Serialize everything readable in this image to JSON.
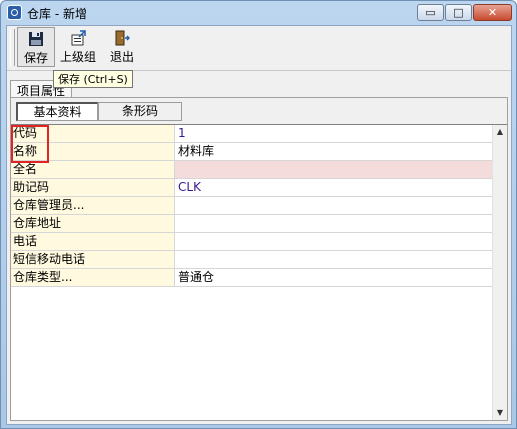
{
  "window": {
    "title": "仓库 - 新增",
    "controls": {
      "minimize": "▭",
      "maximize": "□",
      "close": "✕"
    }
  },
  "toolbar": {
    "save_label": "保存",
    "parent_label": "上级组",
    "exit_label": "退出",
    "tooltip": "保存 (Ctrl+S)"
  },
  "tabs": {
    "outer_label": "项目属性",
    "basic_label": "基本资料",
    "barcode_label": "条形码"
  },
  "grid": {
    "rows": [
      {
        "label": "代码",
        "value": "1"
      },
      {
        "label": "名称",
        "value": "材料库"
      },
      {
        "label": "全名",
        "value": ""
      },
      {
        "label": "助记码",
        "value": "CLK"
      },
      {
        "label": "仓库管理员...",
        "value": ""
      },
      {
        "label": "仓库地址",
        "value": ""
      },
      {
        "label": "电话",
        "value": ""
      },
      {
        "label": "短信移动电话",
        "value": ""
      },
      {
        "label": "仓库类型...",
        "value": "普通仓"
      }
    ]
  },
  "colors": {
    "required_field_bg": "#f4dcdc",
    "label_bg": "#fff9e0",
    "highlight": "#e02424",
    "title_bar": "#bcd6ef"
  }
}
